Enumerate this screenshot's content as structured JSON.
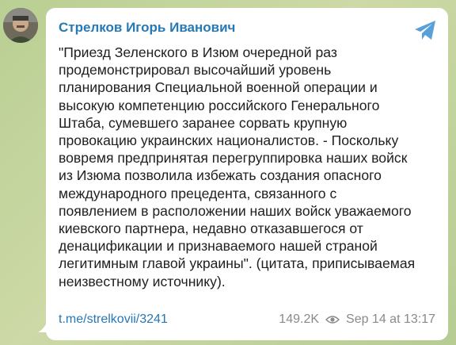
{
  "sender": {
    "name": "Стрелков Игорь Иванович",
    "avatar_icon": "author-avatar"
  },
  "message": {
    "lines": [
      "\"Приезд Зеленского в Изюм очередной раз",
      "продемонстрировал высочайший уровень",
      "планирования Специальной военной операции и",
      "высокую компетенцию российского Генерального",
      "Штаба, сумевшего заранее сорвать крупную",
      "провокацию украинских националистов. - Поскольку",
      "вовремя предпринятая перегруппировка наших войск",
      "из Изюма позволила избежать создания опасного",
      "международного прецедента, связанного с",
      "появлением в расположении наших войск уважаемого",
      "киевского партнера, недавно отказавшегося от",
      "денацификации и признаваемого нашей страной",
      "легитимным главой украины\". (цитата, приписываемая",
      "неизвестному источнику)."
    ]
  },
  "footer": {
    "link": "t.me/strelkovii/3241",
    "views": "149.2K",
    "timestamp": "Sep 14 at 13:17"
  },
  "colors": {
    "accent": "#2678b6",
    "background": "#c9d7a3",
    "bubble": "#ffffff",
    "meta": "#8a8a8a"
  },
  "icons": {
    "share": "share-icon",
    "views": "eye-icon"
  }
}
